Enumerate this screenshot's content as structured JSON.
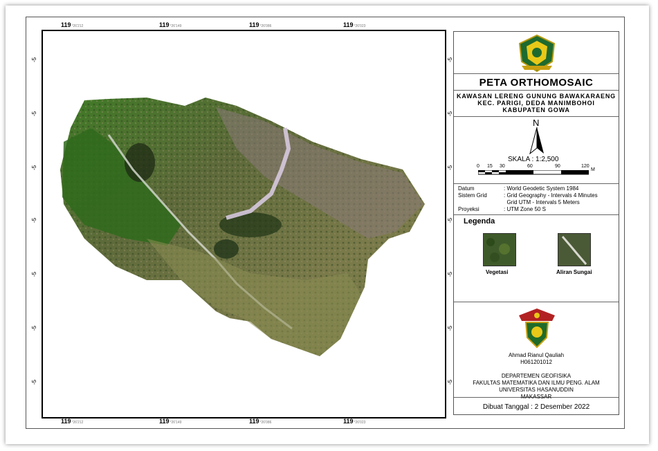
{
  "map": {
    "top_ticks": [
      "119",
      "119",
      "119",
      "119"
    ],
    "bottom_ticks": [
      "119",
      "119",
      "119",
      "119"
    ],
    "tick_suffix_top": [
      "°26'212",
      "°26'149",
      "°26'086",
      "°26'023"
    ],
    "left_ticks": [
      "-5",
      "-5",
      "-5",
      "-5",
      "-5",
      "-5",
      "-5"
    ],
    "right_ticks": [
      "-5",
      "-5",
      "-5",
      "-5",
      "-5",
      "-5",
      "-5"
    ]
  },
  "legend_panel": {
    "title": "PETA ORTHOMOSAIC",
    "subtitle_lines": [
      "KAWASAN LERENG GUNUNG BAWAKARAENG",
      "KEC. PARIGI, DEDA MANIMBOHOI",
      "KABUPATEN GOWA"
    ],
    "north_label": "N",
    "scale_label": "SKALA : 1:2,500",
    "scale_ticks": [
      "0",
      "15",
      "30",
      "60",
      "90",
      "120"
    ],
    "scale_unit": "M",
    "info": [
      {
        "key": "Datum",
        "value": ": World Geodetic System 1984"
      },
      {
        "key": "Sistem Grid",
        "value": ": Grid Geography - Intervals 4 Minutes"
      },
      {
        "key": "",
        "value": "  Grid UTM - Intervals 5 Meters"
      },
      {
        "key": "Proyeksi",
        "value": ": UTM Zone 50 S"
      }
    ],
    "legend_title": "Legenda",
    "legend_items": [
      {
        "label": "Vegetasi",
        "color": "#3f5a2a"
      },
      {
        "label": "Aliran Sungai",
        "color": "#4b5a36"
      }
    ],
    "author_name": "Ahmad Rianul Qauliah",
    "author_id": "H061201012",
    "institution_lines": [
      "DEPARTEMEN GEOFISIKA",
      "FAKULTAS MATEMATIKA DAN ILMU PENG. ALAM",
      "UNIVERSITAS HASANUDDIN",
      "MAKASSAR"
    ],
    "date_label": "Dibuat Tanggal : 2 Desember 2022"
  },
  "colors": {
    "vegetation_dark": "#2f4a1f",
    "vegetation_bright": "#4f8a2c",
    "grass": "#7f8a4a",
    "rock_purple": "#a98aa8",
    "river": "#d8cfe0"
  }
}
